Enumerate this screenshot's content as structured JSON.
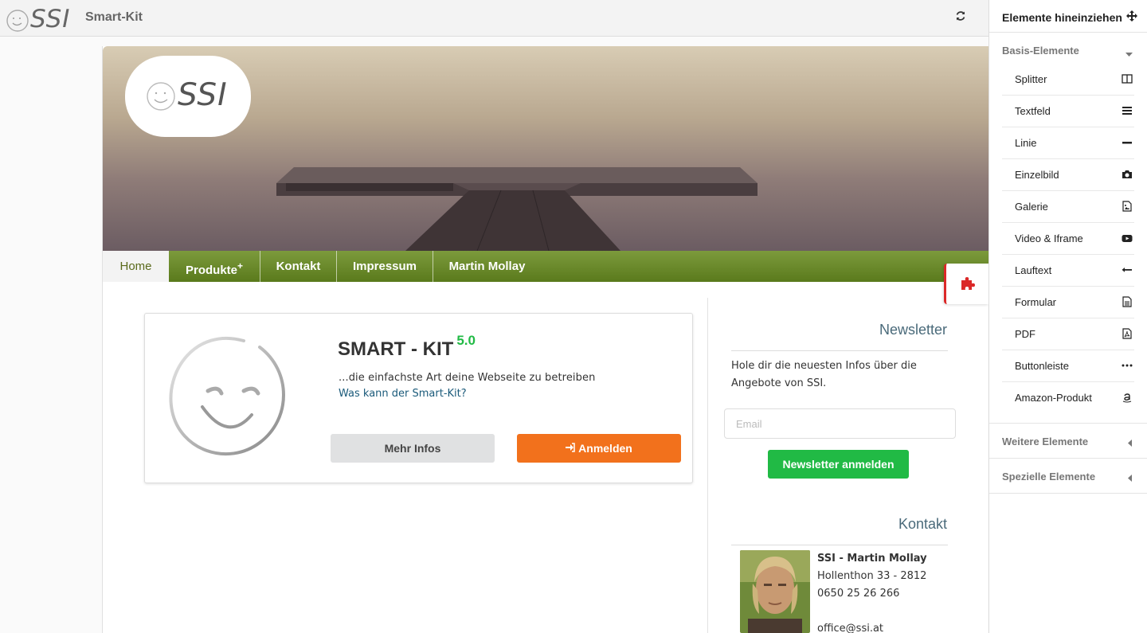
{
  "topbar": {
    "logo_text": "SSI",
    "app_title": "Smart-Kit"
  },
  "hero": {
    "logo_text": "SSI"
  },
  "nav": {
    "items": [
      "Home",
      "Produkte",
      "Kontakt",
      "Impressum",
      "Martin Mollay"
    ],
    "produkte_suffix": "+"
  },
  "card": {
    "title": "SMART - KIT",
    "version": "5.0",
    "description": "...die einfachste Art deine Webseite zu betreiben",
    "link": "Was kann der Smart-Kit?",
    "more_info_label": "Mehr Infos",
    "signin_label": "Anmelden"
  },
  "newsletter": {
    "heading": "Newsletter",
    "text": "Hole dir die neuesten Infos über die Angebote von SSI.",
    "email_placeholder": "Email",
    "button_label": "Newsletter anmelden"
  },
  "contact": {
    "heading": "Kontakt",
    "name": "SSI - Martin Mollay",
    "address": "Hollenthon 33 - 2812",
    "phone": "0650 25 26 266",
    "email": "office@ssi.at"
  },
  "panel": {
    "title": "Elemente hineinziehen",
    "groups": {
      "basis": "Basis-Elemente",
      "weitere": "Weitere Elemente",
      "spezielle": "Spezielle Elemente"
    },
    "items": [
      {
        "label": "Splitter",
        "icon": "columns-icon"
      },
      {
        "label": "Textfeld",
        "icon": "align-justify-icon"
      },
      {
        "label": "Linie",
        "icon": "minus-icon"
      },
      {
        "label": "Einzelbild",
        "icon": "camera-icon"
      },
      {
        "label": "Galerie",
        "icon": "image-file-icon"
      },
      {
        "label": "Video & Iframe",
        "icon": "youtube-icon"
      },
      {
        "label": "Lauftext",
        "icon": "arrow-left-icon"
      },
      {
        "label": "Formular",
        "icon": "file-text-icon"
      },
      {
        "label": "PDF",
        "icon": "pdf-file-icon"
      },
      {
        "label": "Buttonleiste",
        "icon": "ellipsis-icon"
      },
      {
        "label": "Amazon-Produkt",
        "icon": "amazon-icon"
      }
    ]
  },
  "colors": {
    "nav_green": "#6a8a2c",
    "orange": "#f2711c",
    "green": "#21ba45",
    "red": "#db2828"
  }
}
